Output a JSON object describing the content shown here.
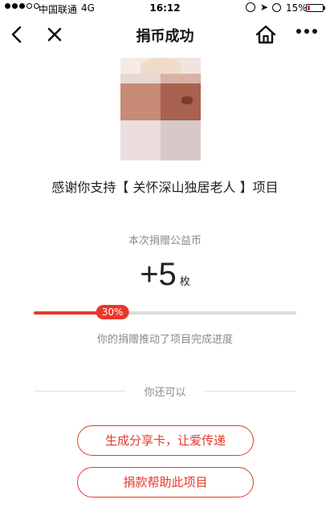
{
  "status_bar": {
    "carrier": "中国联通",
    "network": "4G",
    "time": "16:12",
    "battery": "15%",
    "battery_level": 0.15
  },
  "nav": {
    "title": "捐币成功",
    "icons": [
      "back-icon",
      "close-icon",
      "home-icon",
      "more-icon"
    ]
  },
  "thanks_text": "感谢你支持【 关怀深山独居老人 】项目",
  "coin": {
    "label": "本次捐赠公益币",
    "value": "+5",
    "unit": "枚"
  },
  "progress": {
    "percent_label": "30%",
    "fraction": 0.3,
    "caption": "你的捐赠推动了项目完成进度"
  },
  "divider_text": "你还可以",
  "buttons": {
    "share": "生成分享卡，让爱传递",
    "donate": "捐款帮助此项目"
  },
  "colors": {
    "accent": "#e8382b",
    "muted_text": "#8a8a8a",
    "track": "#dcdcdc"
  }
}
